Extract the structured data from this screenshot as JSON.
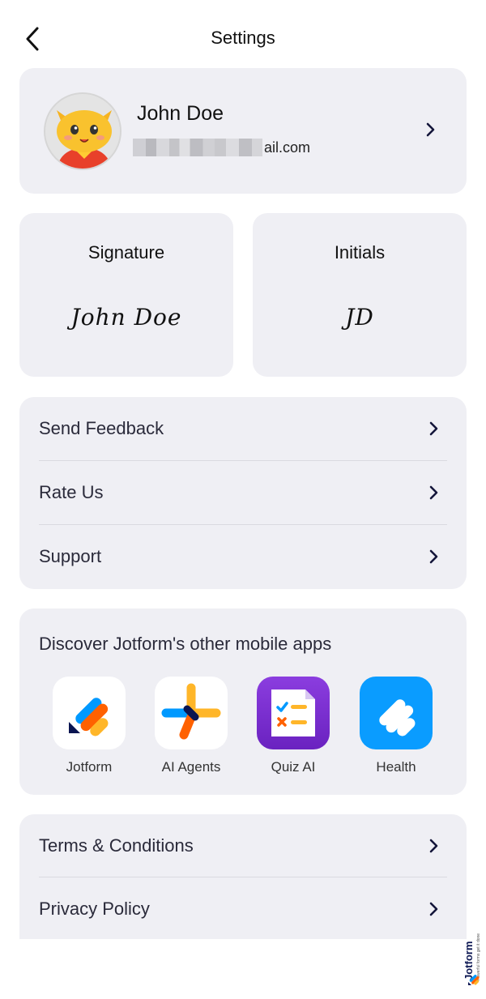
{
  "header": {
    "title": "Settings"
  },
  "profile": {
    "name": "John Doe",
    "email_visible": "ail.com"
  },
  "signature": {
    "title": "Signature",
    "value": "John Doe"
  },
  "initials": {
    "title": "Initials",
    "value": "JD"
  },
  "support_list": [
    {
      "label": "Send Feedback"
    },
    {
      "label": "Rate Us"
    },
    {
      "label": "Support"
    }
  ],
  "apps": {
    "title": "Discover Jotform's other mobile apps",
    "items": [
      {
        "label": "Jotform",
        "icon": "jotform-app-icon"
      },
      {
        "label": "AI Agents",
        "icon": "ai-agents-app-icon"
      },
      {
        "label": "Quiz AI",
        "icon": "quiz-ai-app-icon"
      },
      {
        "label": "Health",
        "icon": "health-app-icon"
      }
    ]
  },
  "legal_list": [
    {
      "label": "Terms & Conditions"
    },
    {
      "label": "Privacy Policy"
    }
  ],
  "brand": {
    "name": "Jotform",
    "tagline": "Powerful forms get it done"
  },
  "colors": {
    "card_bg": "#efeff4",
    "chevron": "#14163a",
    "quiz_purple": "#7b2fd0",
    "health_blue": "#0a9cff",
    "jotform_orange": "#ff6100",
    "jotform_blue": "#0099ff",
    "jotform_yellow": "#ffb629"
  }
}
